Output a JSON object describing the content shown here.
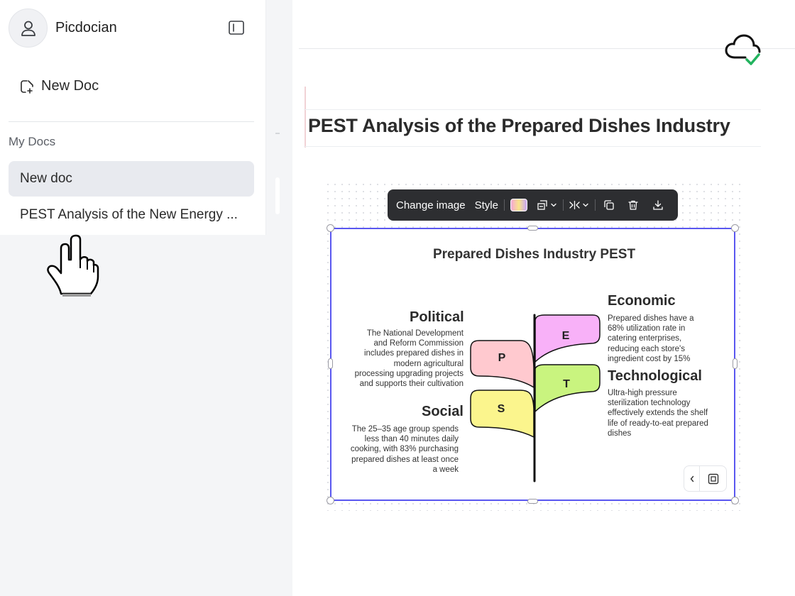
{
  "sidebar": {
    "user_name": "Picdocian",
    "new_doc_label": "New Doc",
    "section_label": "My Docs",
    "docs": [
      {
        "label": "New doc",
        "active": true
      },
      {
        "label": "PEST Analysis of the New Energy ...",
        "active": false
      }
    ]
  },
  "document": {
    "title": "PEST Analysis of the Prepared Dishes Industry"
  },
  "image_toolbar": {
    "change_image_label": "Change image",
    "style_label": "Style",
    "icons": [
      "color-swatch",
      "layout-icon",
      "chevron-down-icon",
      "flip-icon",
      "chevron-down-icon",
      "copy-icon",
      "trash-icon",
      "download-icon"
    ]
  },
  "infographic": {
    "title": "Prepared Dishes Industry PEST",
    "political": {
      "title": "Political",
      "body": "The National Development and Reform Commission includes prepared dishes in modern agricultural processing upgrading projects and supports their cultivation"
    },
    "social": {
      "title": "Social",
      "body": "The 25–35 age group spends less than 40 minutes daily cooking, with 83% purchasing prepared dishes at least once a week"
    },
    "economic": {
      "title": "Economic",
      "body": "Prepared dishes have a 68% utilization rate in catering enterprises, reducing each store's ingredient cost by 15%"
    },
    "technological": {
      "title": "Technological",
      "body": "Ultra-high pressure sterilization technology effectively extends the shelf life of ready-to-eat prepared dishes"
    },
    "leaves": {
      "p": "P",
      "e": "E",
      "t": "T",
      "s": "S"
    },
    "leaf_colors": {
      "p": "#ffc9cf",
      "e": "#f8b1f8",
      "t": "#c9f47f",
      "s": "#fbf58d"
    }
  },
  "colors": {
    "selection": "#5a57f0",
    "toolbar_bg": "#2d2e31",
    "sync_ok": "#22b35e"
  }
}
